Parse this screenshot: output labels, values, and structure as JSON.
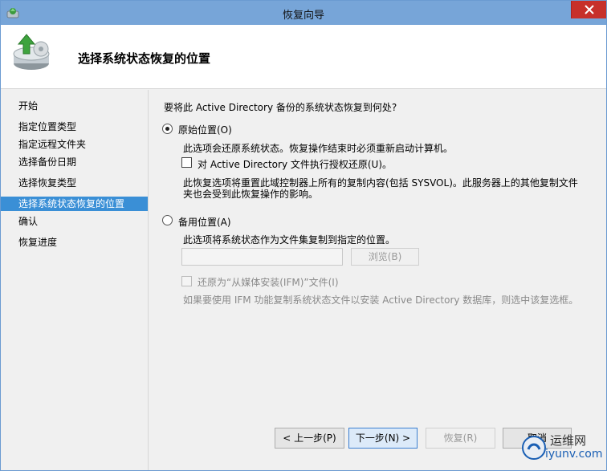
{
  "window": {
    "title": "恢复向导"
  },
  "header": {
    "heading": "选择系统状态恢复的位置"
  },
  "sidebar": {
    "steps": [
      {
        "label": "开始"
      },
      {
        "label": "指定位置类型"
      },
      {
        "label": "指定远程文件夹"
      },
      {
        "label": "选择备份日期"
      },
      {
        "label": "选择恢复类型"
      },
      {
        "label": "选择系统状态恢复的位置",
        "active": true
      },
      {
        "label": "确认"
      },
      {
        "label": "恢复进度"
      }
    ]
  },
  "main": {
    "question": "要将此 Active Directory 备份的系统状态恢复到何处?",
    "original": {
      "label": "原始位置(O)",
      "selected": true,
      "desc": "此选项会还原系统状态。恢复操作结束时必须重新启动计算机。",
      "auth_restore_label": "对 Active Directory 文件执行授权还原(U)。",
      "auth_restore_checked": false,
      "note_line1": "此恢复选项将重置此域控制器上所有的复制内容(包括 SYSVOL)。此服务器上的其他复制文件",
      "note_line2": "夹也会受到此恢复操作的影响。"
    },
    "alternate": {
      "label": "备用位置(A)",
      "selected": false,
      "desc": "此选项将系统状态作为文件集复制到指定的位置。",
      "path_value": "",
      "browse_label": "浏览(B)",
      "ifm_label": "还原为“从媒体安装(IFM)”文件(I)",
      "ifm_checked": false,
      "ifm_note": "如果要使用 IFM 功能复制系统状态文件以安装 Active Directory 数据库，则选中该复选框。"
    }
  },
  "footer": {
    "back_label": "< 上一步(P)",
    "next_label": "下一步(N) >",
    "restore_label": "恢复(R)",
    "cancel_label": "取消"
  },
  "watermark": {
    "line1": "运维网",
    "line2": "iyunv.com"
  },
  "colors": {
    "titlebar": "#77a5d8",
    "active_step": "#3a8fd6",
    "close": "#c7302a"
  },
  "icons": {
    "app": "backup-app-icon",
    "wizard": "restore-drive-icon",
    "close": "close-icon"
  }
}
